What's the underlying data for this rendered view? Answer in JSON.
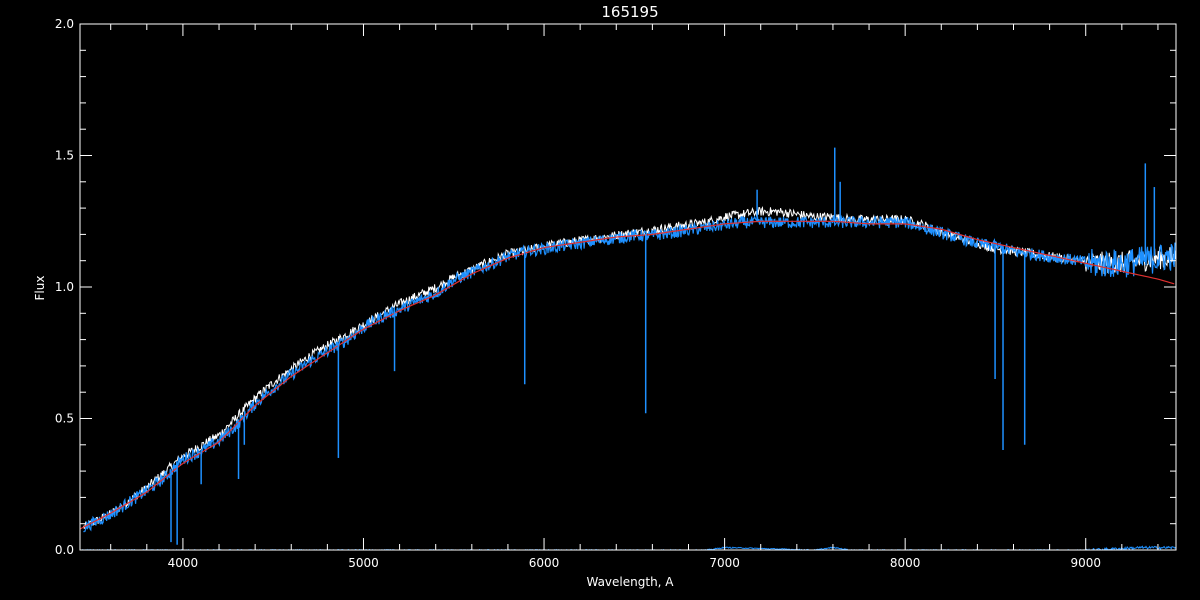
{
  "chart_data": {
    "type": "line",
    "title": "165195",
    "xlabel": "Wavelength, A",
    "ylabel": "Flux",
    "xlim": [
      3430,
      9500
    ],
    "ylim": [
      0.0,
      2.0
    ],
    "grid": false,
    "legend": "none",
    "x_ticks": [
      4000,
      5000,
      6000,
      7000,
      8000,
      9000
    ],
    "y_ticks": [
      "0.0",
      "0.5",
      "1.0",
      "1.5",
      "2.0"
    ],
    "x_minor_step": 200,
    "y_minor_step": 0.1,
    "colors": {
      "background": "#000000",
      "axes": "#ffffff",
      "observed": "#ffffff",
      "model": "#1e90ff",
      "continuum": "#e03030",
      "error": "#1e90ff"
    },
    "series": [
      {
        "style": "observed-white",
        "x": [
          3450,
          3600,
          3800,
          3900,
          4000,
          4100,
          4200,
          4300,
          4400,
          4500,
          4600,
          4700,
          4800,
          4900,
          5000,
          5100,
          5200,
          5300,
          5400,
          5500,
          5600,
          5700,
          5800,
          5900,
          6000,
          6100,
          6200,
          6300,
          6400,
          6500,
          6600,
          6700,
          6800,
          6900,
          7000,
          7100,
          7200,
          7300,
          7400,
          7500,
          7600,
          7700,
          7800,
          7900,
          8000,
          8100,
          8200,
          8300,
          8400,
          8500,
          8600,
          8700,
          8800,
          8900,
          9000,
          9100,
          9200,
          9300,
          9400,
          9500
        ],
        "y": [
          0.09,
          0.14,
          0.24,
          0.3,
          0.36,
          0.4,
          0.44,
          0.51,
          0.58,
          0.64,
          0.69,
          0.74,
          0.78,
          0.82,
          0.86,
          0.9,
          0.94,
          0.97,
          1.0,
          1.04,
          1.07,
          1.1,
          1.13,
          1.14,
          1.16,
          1.17,
          1.18,
          1.19,
          1.2,
          1.21,
          1.22,
          1.23,
          1.24,
          1.25,
          1.27,
          1.28,
          1.29,
          1.29,
          1.28,
          1.27,
          1.27,
          1.26,
          1.26,
          1.26,
          1.26,
          1.24,
          1.21,
          1.19,
          1.17,
          1.15,
          1.14,
          1.13,
          1.12,
          1.11,
          1.1,
          1.1,
          1.1,
          1.11,
          1.12,
          1.12
        ]
      },
      {
        "style": "model-blue",
        "x": [
          3450,
          3600,
          3800,
          3900,
          4000,
          4100,
          4200,
          4300,
          4400,
          4500,
          4600,
          4700,
          4800,
          4900,
          5000,
          5100,
          5200,
          5300,
          5400,
          5500,
          5600,
          5700,
          5800,
          5900,
          6000,
          6100,
          6200,
          6300,
          6400,
          6500,
          6600,
          6700,
          6800,
          6900,
          7000,
          7100,
          7200,
          7300,
          7400,
          7500,
          7600,
          7700,
          7800,
          7900,
          8000,
          8100,
          8200,
          8300,
          8400,
          8500,
          8600,
          8700,
          8800,
          8900,
          9000,
          9100,
          9200,
          9300,
          9400,
          9500
        ],
        "y": [
          0.09,
          0.14,
          0.23,
          0.28,
          0.35,
          0.38,
          0.42,
          0.48,
          0.56,
          0.62,
          0.67,
          0.72,
          0.76,
          0.8,
          0.85,
          0.89,
          0.92,
          0.95,
          0.98,
          1.03,
          1.06,
          1.09,
          1.12,
          1.14,
          1.15,
          1.16,
          1.17,
          1.18,
          1.19,
          1.2,
          1.2,
          1.21,
          1.22,
          1.23,
          1.24,
          1.25,
          1.25,
          1.25,
          1.25,
          1.25,
          1.25,
          1.25,
          1.25,
          1.25,
          1.25,
          1.23,
          1.21,
          1.19,
          1.17,
          1.16,
          1.14,
          1.13,
          1.12,
          1.11,
          1.1,
          1.1,
          1.1,
          1.11,
          1.12,
          1.13
        ]
      },
      {
        "style": "continuum-red",
        "x": [
          3430,
          3600,
          3800,
          4000,
          4200,
          4400,
          4600,
          4800,
          5000,
          5200,
          5400,
          5600,
          5800,
          6000,
          6200,
          6400,
          6600,
          6800,
          7000,
          7200,
          7400,
          7600,
          7800,
          8000,
          8200,
          8400,
          8600,
          8800,
          9000,
          9200,
          9400,
          9500
        ],
        "y": [
          0.08,
          0.14,
          0.22,
          0.33,
          0.41,
          0.55,
          0.66,
          0.75,
          0.84,
          0.91,
          0.97,
          1.05,
          1.11,
          1.15,
          1.17,
          1.19,
          1.2,
          1.22,
          1.24,
          1.25,
          1.25,
          1.25,
          1.24,
          1.24,
          1.22,
          1.18,
          1.15,
          1.12,
          1.09,
          1.06,
          1.03,
          1.01
        ]
      },
      {
        "style": "error-blue",
        "x": [
          3430,
          5000,
          6000,
          6900,
          7000,
          7500,
          7600,
          7700,
          8000,
          9000,
          9300,
          9500
        ],
        "y": [
          0.0,
          0.0,
          0.0,
          0.0,
          0.01,
          0.0,
          0.01,
          0.0,
          0.0,
          0.0,
          0.01,
          0.01
        ]
      }
    ],
    "absorption_lines": [
      {
        "x": 3934,
        "y": 0.03
      },
      {
        "x": 3968,
        "y": 0.02
      },
      {
        "x": 4101,
        "y": 0.25
      },
      {
        "x": 4308,
        "y": 0.27
      },
      {
        "x": 4340,
        "y": 0.4
      },
      {
        "x": 4861,
        "y": 0.35
      },
      {
        "x": 5172,
        "y": 0.68
      },
      {
        "x": 5893,
        "y": 0.63
      },
      {
        "x": 6563,
        "y": 0.52
      },
      {
        "x": 8498,
        "y": 0.65
      },
      {
        "x": 8542,
        "y": 0.38
      },
      {
        "x": 8662,
        "y": 0.4
      }
    ],
    "spikes": [
      {
        "x": 7180,
        "y": 1.37
      },
      {
        "x": 7610,
        "y": 1.53
      },
      {
        "x": 7640,
        "y": 1.4
      },
      {
        "x": 9330,
        "y": 1.47
      },
      {
        "x": 9380,
        "y": 1.38
      }
    ]
  }
}
